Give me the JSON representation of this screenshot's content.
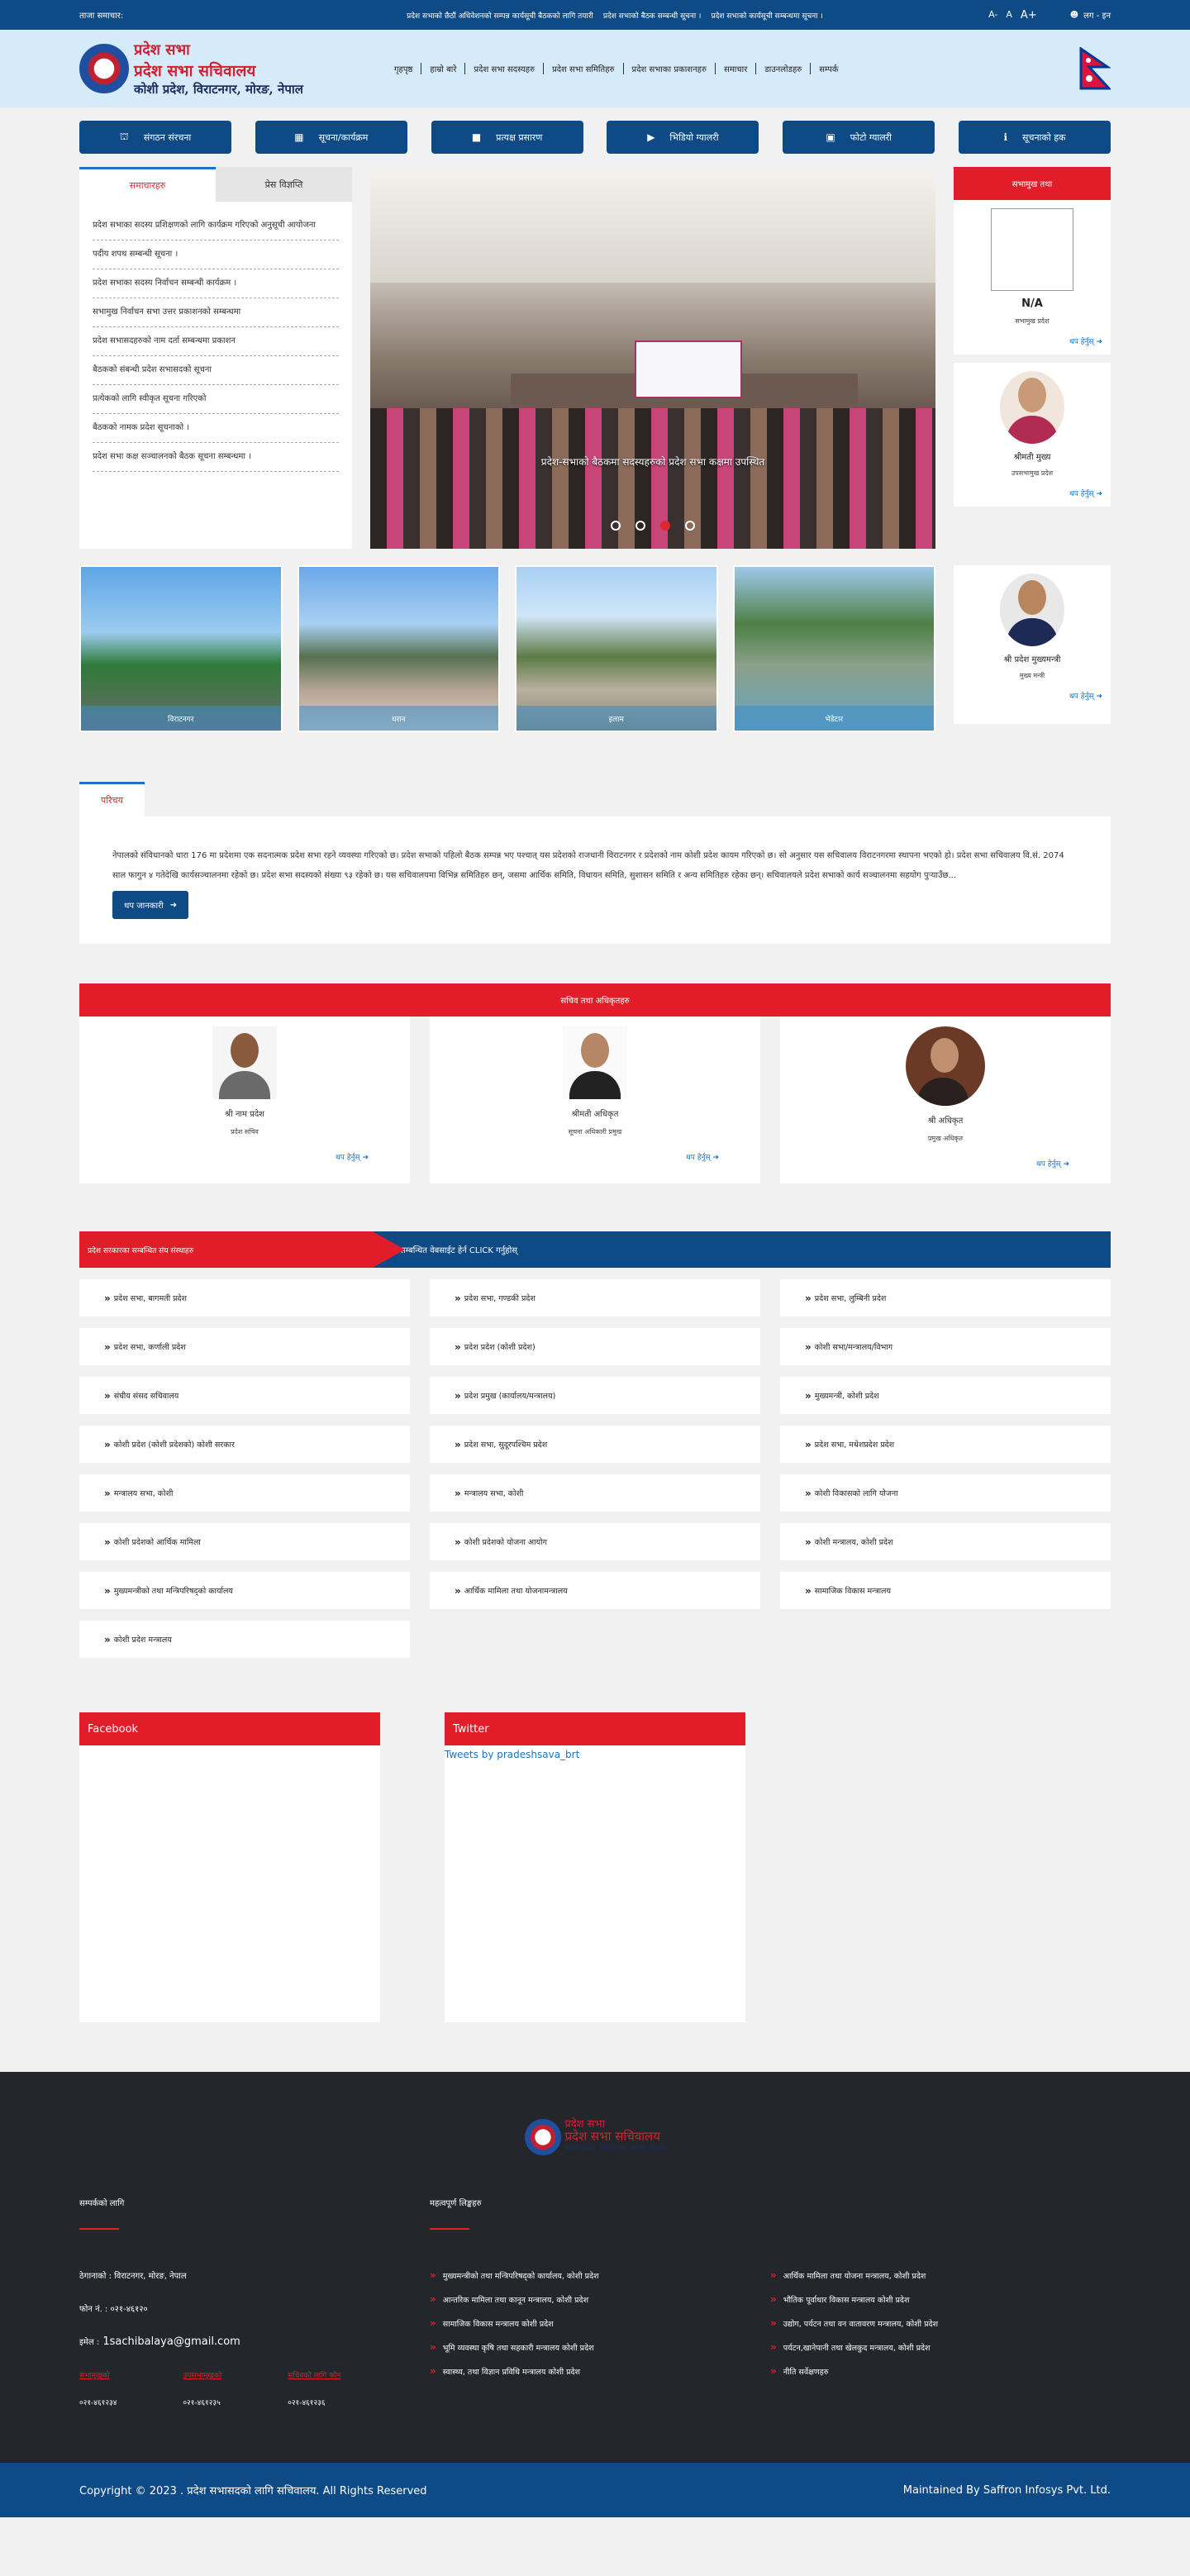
{
  "topbar": {
    "label": "ताजा समाचार:",
    "news": [
      "प्रदेश सभाको छैठौं अधिवेशनको सम्पन्न कार्यसूची बैठकको लागि तयारी",
      "प्रदेश सभाको बैठक सम्बन्धी सूचना ।",
      "प्रदेश सभाको कार्यसूची सम्बन्धमा सूचना ।"
    ],
    "font_small": "A-",
    "font_normal": "A",
    "font_large": "A+",
    "login": "लग - इन"
  },
  "header": {
    "logo_line1": "प्रदेश सभा",
    "logo_line2": "प्रदेश सभा सचिवालय",
    "logo_line3": "कोशी प्रदेश, विराटनगर, मोरङ, नेपाल",
    "nav": [
      "गृहपृष्ठ",
      "हाम्रो बारे",
      "प्रदेश सभा सदस्यहरु",
      "प्रदेश सभा समितिहरु",
      "प्रदेश सभाका प्रकाशनहरु",
      "समाचार",
      "डाउनलोडहरु",
      "सम्पर्क"
    ]
  },
  "quick_buttons": [
    {
      "icon": "sitemap-icon",
      "glyph": "⛫",
      "label": "संगठन संरचना"
    },
    {
      "icon": "calendar-icon",
      "glyph": "▦",
      "label": "सूचना/कार्यक्रम"
    },
    {
      "icon": "video-camera-icon",
      "glyph": "■",
      "label": "प्रत्यक्ष प्रसारण"
    },
    {
      "icon": "youtube-icon",
      "glyph": "▶",
      "label": "भिडियो ग्यालरी"
    },
    {
      "icon": "gallery-icon",
      "glyph": "▣",
      "label": "फोटो ग्यालरी"
    },
    {
      "icon": "info-icon",
      "glyph": "ℹ",
      "label": "सूचनाको हक"
    }
  ],
  "newsbox": {
    "tab_active": "समाचारहरु",
    "tab_inactive": "प्रेस विज्ञप्ति",
    "items": [
      "प्रदेश सभाका सदस्य प्रशिक्षणको लागि कार्यक्रम गरिएको अनुसूची आयोजना",
      "पदीय शपथ सम्बन्धी सूचना ।",
      "प्रदेश सभाका सदस्य निर्वाचन सम्बन्धी कार्यक्रम ।",
      "सभामुख निर्वाचन सभा उत्तर प्रकाशनको सम्बन्धमा",
      "प्रदेश सभासदहरुको नाम दर्ता सम्बन्धमा प्रकाशन",
      "बैठकको संबन्धी प्रदेश सभासदको सूचना",
      "प्रत्येकको लागि स्वीकृत सूचना गरिएको",
      "बैठकको नामक प्रदेश सूचनाको ।",
      "प्रदेश सभा कक्ष सञ्चालनको बैठक सूचना सम्बन्धमा ।"
    ]
  },
  "slider": {
    "caption": "प्रदेश-सभाको बैठकमा सदस्यहरुको प्रदेश सभा कक्षमा उपस्थित",
    "dots": 4,
    "active_dot": 3
  },
  "rightcol": {
    "header": "सभामुख तथा",
    "cards": [
      {
        "name": "N/A",
        "post": "सभामुख प्रदेश",
        "more": "थप हेर्नुस्",
        "img": "blank"
      },
      {
        "name": "श्रीमती मुख्य",
        "post": "उपसभामुख प्रदेश",
        "more": "थप हेर्नुस्",
        "img": "female"
      },
      {
        "name": "श्री प्रदेश मुख्यमन्त्री",
        "post": "मुख्य मन्त्री",
        "more": "थप हेर्नुस्",
        "img": "male"
      }
    ]
  },
  "gallery": [
    {
      "label": "विराटनगर"
    },
    {
      "label": "धरान"
    },
    {
      "label": "इलाम"
    },
    {
      "label": "भेडेटार"
    }
  ],
  "about": {
    "tab": "परिचय",
    "text": "नेपालको संविधानको धारा 176 मा प्रदेशमा एक सदनात्मक प्रदेश सभा रहने व्यवस्था गरिएको छ। प्रदेश सभाको पहिलो बैठक सम्पन्न भए पश्चात् यस प्रदेशको राजधानी विराटनगर र प्रदेशको नाम कोशी प्रदेश कायम गरिएको छ। सो अनुसार यस सचिवालय विराटनगरमा स्थापना भएको हो। प्रदेश सभा सचिवालय वि.सं. 2074 साल फागुन ४ गतेदेखि कार्यसञ्चालनमा रहेको छ। प्रदेश सभा सदस्यको संख्या ९३ रहेको छ। यस सचिवालयमा विभिन्न समितिहरु छन्, जसमा आर्थिक समिति, विधायन समिति, सुशासन समिति र अन्य समितिहरु रहेका छन्। सचिवालयले प्रदेश सभाको कार्य सञ्चालनमा सहयोग पुर्‍याउँछ...",
    "more": "थप जानकारी"
  },
  "officials": {
    "header": "सचिव तथा अधिकृतहरु",
    "cards": [
      {
        "name": "श्री नाम प्रदेश",
        "post": "प्रदेश सचिव",
        "more": "थप हेर्नुस्",
        "img": "male2"
      },
      {
        "name": "श्रीमती अधिकृत",
        "post": "सूचना अधिकारी प्रमुख",
        "more": "थप हेर्नुस्",
        "img": "female2"
      },
      {
        "name": "श्री अधिकृत",
        "post": "प्रमुख अधिकृत",
        "more": "थप हेर्नुस्",
        "img": "male3"
      }
    ]
  },
  "links": {
    "header_left": "प्रदेश सरकारका सम्बन्धित संघ संस्थाहरु",
    "header_right": "सम्बन्धित वेबसाईट हेर्न CLICK गर्नुहोस्",
    "items": [
      "प्रदेश सभा, बागमती प्रदेश",
      "प्रदेश सभा, गण्डकी प्रदेश",
      "प्रदेश सभा, लुम्बिनी प्रदेश",
      "प्रदेश सभा, कर्णाली प्रदेश",
      "प्रदेश प्रदेश (कोशी प्रदेश)",
      "कोशी सभा/मन्त्रालय/विभाग",
      "संघीय संसद सचिवालय",
      "प्रदेश प्रमुख (कार्यालय/मन्त्रालय)",
      "मुख्यमन्त्री, कोशी प्रदेश",
      "कोशी प्रदेश (कोशी प्रदेशको) कोशी सरकार",
      "प्रदेश सभा, सुदूरपश्चिम प्रदेश",
      "प्रदेश सभा, मधेशप्रदेश प्रदेश",
      "मन्त्रालय सभा, कोशी",
      "मन्त्रालय सभा, कोशी",
      "कोशी विकासको लागि योजना",
      "कोशी प्रदेशको आर्थिक मामिला",
      "कोशी प्रदेशको योजना आयोग",
      "कोशी मन्त्रालय, कोशी प्रदेश",
      "मुख्यमन्त्रीको तथा मन्त्रिपरिषद्को कार्यालय",
      "आर्थिक मामिला तथा योजनामन्त्रालय",
      "सामाजिक विकास मन्त्रालय",
      "कोशी प्रदेश मन्त्रालय"
    ]
  },
  "social": {
    "facebook": "Facebook",
    "twitter": "Twitter",
    "twitter_link": "Tweets by pradeshsava_brt"
  },
  "footer": {
    "logo_line1": "प्रदेश सभा",
    "logo_line2": "प्रदेश सभा सचिवालय",
    "logo_line3": "कोशी प्रदेश, विराटनगर, मोरङ, नेपाल",
    "contact_head": "सम्पर्कको लागि",
    "address": "ठेगानाको : विराटनगर, मोरङ, नेपाल",
    "phone": "फोन नं. : ०२१-४६१२०",
    "email_label": "इमेल :",
    "email": "1sachibalaya@gmail.com",
    "phones": [
      {
        "label": "सभामुखको",
        "number": "०२१-४६१२३४"
      },
      {
        "label": "उपसभामुखको",
        "number": "०२१-४६१२३५"
      },
      {
        "label": "सचिवको लागि फोन",
        "number": "०२१-४६१२३६"
      }
    ],
    "links_head": "महत्वपूर्ण लिङ्कहरु",
    "links": [
      "मुख्यमन्त्रीको तथा मन्त्रिपरिषद्को कार्यालय, कोशी प्रदेश",
      "आर्थिक मामिला तथा योजना मन्त्रालय, कोशी प्रदेश",
      "आन्तरिक मामिला तथा कानून मन्त्रालय, कोशी प्रदेश",
      "भौतिक पूर्वाधार विकास मन्त्रालय कोशी प्रदेश",
      "सामाजिक विकास मन्त्रालय कोशी प्रदेश",
      "उद्योग, पर्यटन तथा वन वातावरण मन्त्रालय, कोशी प्रदेश",
      "भूमि व्यवस्था कृषि तथा सहकारी मन्त्रालय कोशी प्रदेश",
      "पर्यटन,खानेपानी तथा खेलकुद मन्त्रालय, कोशी प्रदेश",
      "स्वास्थ्य, तथा विज्ञान प्रविधि मन्त्रालय कोशी प्रदेश",
      "नीति सर्वेक्षणहरु"
    ]
  },
  "copyright": {
    "left": "Copyright © 2023 . प्रदेश सभासदको लागि सचिवालय. All Rights Reserved",
    "right": "Maintained By Saffron Infosys Pvt. Ltd."
  }
}
